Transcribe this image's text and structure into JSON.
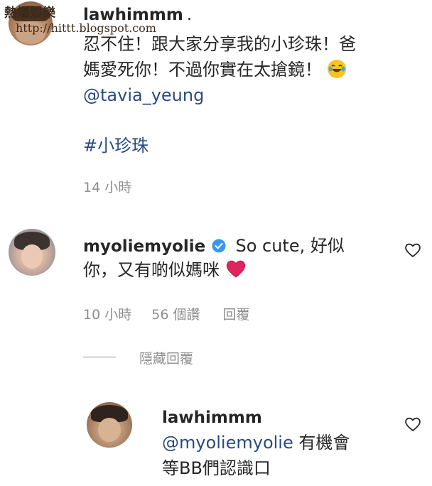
{
  "watermark": {
    "line1": "熱爆娛樂",
    "line2": "http://hittt.blogspot.com"
  },
  "post": {
    "username": "lawhimmm",
    "username_suffix": ".",
    "text_line1": "忍不住！跟大家分享我的小珍珠！爸",
    "text_line2": "媽愛死你！不過你實在太搶鏡！",
    "emoji": "laughing-tears-emoji",
    "mention": "@tavia_yeung",
    "hashtag": "#小珍珠",
    "time": "14 小時"
  },
  "comment": {
    "username": "myoliemyolie",
    "verified": true,
    "text_line1": "So cute, 好似",
    "text_line2": "你，又有啲似媽咪",
    "time": "10 小時",
    "likes": "56 個讚",
    "reply_label": "回覆",
    "hide_replies": "隱藏回覆"
  },
  "reply": {
    "username": "lawhimmm",
    "mention": "@myoliemyolie",
    "text_after_mention": " 有機會",
    "text_line2": "等BB們認識口"
  },
  "colors": {
    "link": "#2a4a7f",
    "meta": "#8e8e8e",
    "verified": "#3897f0",
    "heart": "#e0245e"
  }
}
